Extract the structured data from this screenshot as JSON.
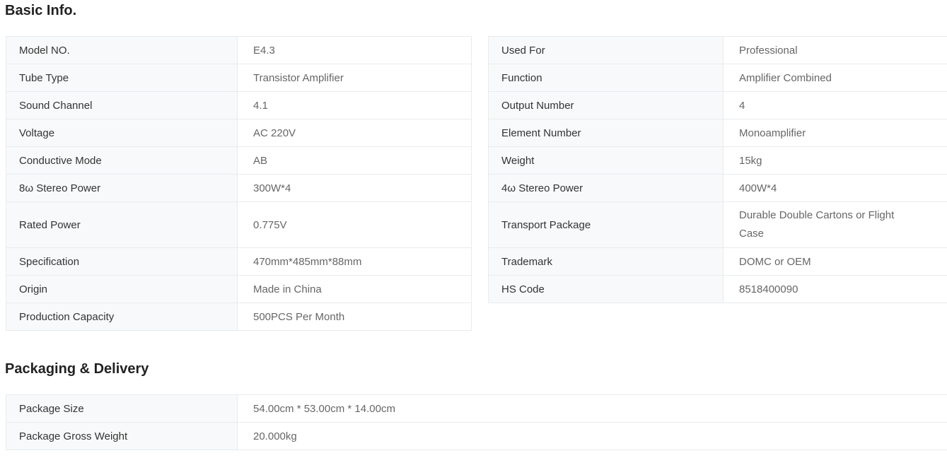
{
  "colors": {
    "label_cell_bg": "#f8f9fa",
    "border": "#e8ebee",
    "label_text": "#333333",
    "value_text": "#666666",
    "heading_text": "#222222",
    "page_bg": "#ffffff"
  },
  "basic_info": {
    "title": "Basic Info.",
    "left_rows": [
      {
        "label": "Model NO.",
        "value": "E4.3"
      },
      {
        "label": "Tube Type",
        "value": "Transistor Amplifier"
      },
      {
        "label": "Sound Channel",
        "value": "4.1"
      },
      {
        "label": "Voltage",
        "value": "AC 220V"
      },
      {
        "label": "Conductive Mode",
        "value": "AB"
      },
      {
        "label": "8ω Stereo Power",
        "value": "300W*4"
      },
      {
        "label": "Rated Power",
        "value": "0.775V"
      },
      {
        "label": "Specification",
        "value": "470mm*485mm*88mm"
      },
      {
        "label": "Origin",
        "value": "Made in China"
      },
      {
        "label": "Production Capacity",
        "value": "500PCS Per Month"
      }
    ],
    "right_rows": [
      {
        "label": "Used For",
        "value": "Professional"
      },
      {
        "label": "Function",
        "value": "Amplifier Combined"
      },
      {
        "label": "Output Number",
        "value": "4"
      },
      {
        "label": "Element Number",
        "value": "Monoamplifier"
      },
      {
        "label": "Weight",
        "value": "15kg"
      },
      {
        "label": "4ω Stereo Power",
        "value": "400W*4"
      },
      {
        "label": "Transport Package",
        "value": "Durable Double Cartons or Flight Case"
      },
      {
        "label": "Trademark",
        "value": "DOMC or OEM"
      },
      {
        "label": "HS Code",
        "value": "8518400090"
      }
    ]
  },
  "packaging": {
    "title": "Packaging & Delivery",
    "rows": [
      {
        "label": "Package Size",
        "value": "54.00cm * 53.00cm * 14.00cm"
      },
      {
        "label": "Package Gross Weight",
        "value": "20.000kg"
      }
    ]
  }
}
